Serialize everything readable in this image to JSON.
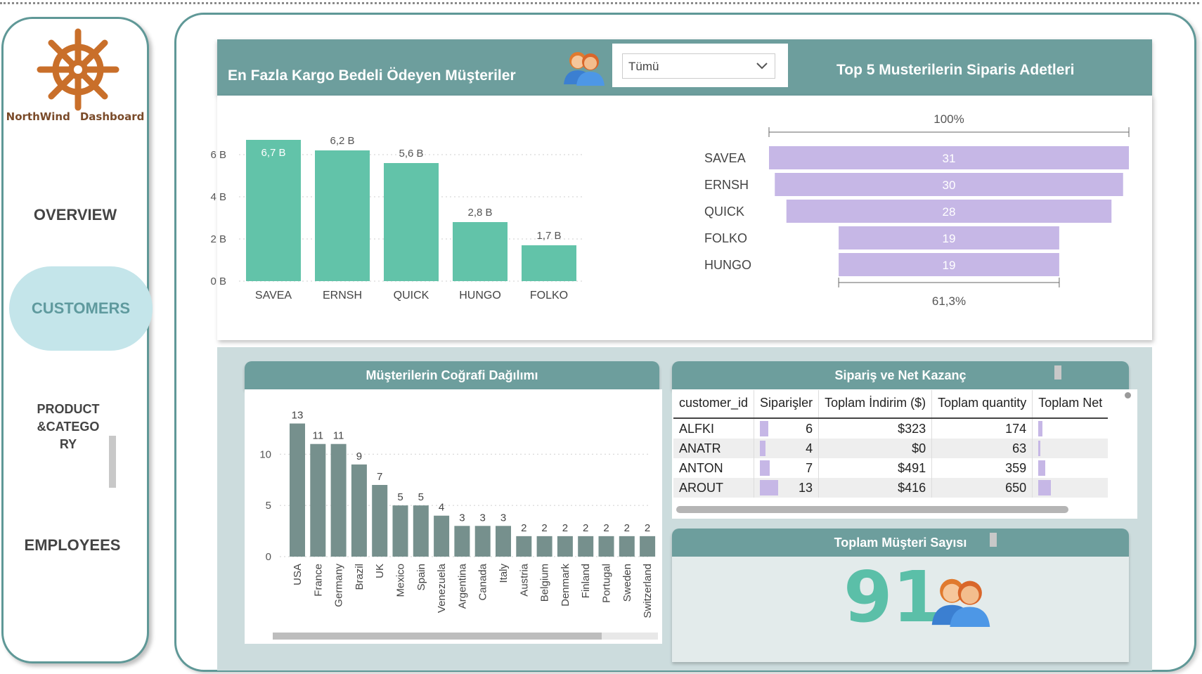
{
  "sidebar": {
    "brand": [
      "NorthWind",
      "Dashboard"
    ],
    "nav": {
      "overview": "OVERVIEW",
      "customers": "CUSTOMERS",
      "product_lines": [
        "PRODUCT",
        "&CATEGO",
        "RY"
      ],
      "employees": "EMPLOYEES"
    }
  },
  "header": {
    "left_title": "En Fazla Kargo Bedeli Ödeyen Müşteriler",
    "right_title": "Top 5 Musterilerin Siparis Adetleri",
    "filter": {
      "selected": "Tümü"
    }
  },
  "chart_data": [
    {
      "type": "bar",
      "title": "En Fazla Kargo Bedeli Ödeyen Müşteriler",
      "categories": [
        "SAVEA",
        "ERNSH",
        "QUICK",
        "HUNGO",
        "FOLKO"
      ],
      "values": [
        6.7,
        6.2,
        5.6,
        2.8,
        1.7
      ],
      "data_labels": [
        "6,7 B",
        "6,2 B",
        "5,6 B",
        "2,8 B",
        "1,7 B"
      ],
      "yticks": [
        "0 B",
        "2 B",
        "4 B",
        "6 B"
      ],
      "ylim": [
        0,
        7
      ],
      "color": "#62c3a9",
      "grid": true
    },
    {
      "type": "funnel",
      "title": "Top 5 Musterilerin Siparis Adetleri",
      "categories": [
        "SAVEA",
        "ERNSH",
        "QUICK",
        "FOLKO",
        "HUNGO"
      ],
      "values": [
        31,
        30,
        28,
        19,
        19
      ],
      "top_label": "100%",
      "bottom_label": "61,3%",
      "color": "#c6b7e6"
    },
    {
      "type": "bar",
      "title": "Müşterilerin Coğrafi Dağılımı",
      "categories": [
        "USA",
        "France",
        "Germany",
        "Brazil",
        "UK",
        "Mexico",
        "Spain",
        "Venezuela",
        "Argentina",
        "Canada",
        "Italy",
        "Austria",
        "Belgium",
        "Denmark",
        "Finland",
        "Portugal",
        "Sweden",
        "Switzerland"
      ],
      "values": [
        13,
        11,
        11,
        9,
        7,
        5,
        5,
        4,
        3,
        3,
        3,
        2,
        2,
        2,
        2,
        2,
        2,
        2
      ],
      "yticks": [
        "0",
        "5",
        "10"
      ],
      "ylim": [
        0,
        14
      ],
      "color": "#76908d",
      "grid": true
    }
  ],
  "geo_panel": {
    "title": "Müşterilerin Coğrafi Dağılımı"
  },
  "table_panel": {
    "title": "Sipariş ve Net Kazanç",
    "columns": [
      "customer_id",
      "Siparişler",
      "Toplam İndirim ($)",
      "Toplam quantity",
      "Toplam Net"
    ],
    "rows": [
      {
        "id": "ALFKI",
        "orders": "6",
        "discount": "$323",
        "quantity": "174",
        "orders_bar": 0.46,
        "net_bar": 0.2
      },
      {
        "id": "ANATR",
        "orders": "4",
        "discount": "$0",
        "quantity": "63",
        "orders_bar": 0.3,
        "net_bar": 0.1
      },
      {
        "id": "ANTON",
        "orders": "7",
        "discount": "$491",
        "quantity": "359",
        "orders_bar": 0.54,
        "net_bar": 0.33
      },
      {
        "id": "AROUT",
        "orders": "13",
        "discount": "$416",
        "quantity": "650",
        "orders_bar": 1.0,
        "net_bar": 0.6
      }
    ]
  },
  "customer_count": {
    "title": "Toplam Müşteri Sayısı",
    "value": "91"
  }
}
